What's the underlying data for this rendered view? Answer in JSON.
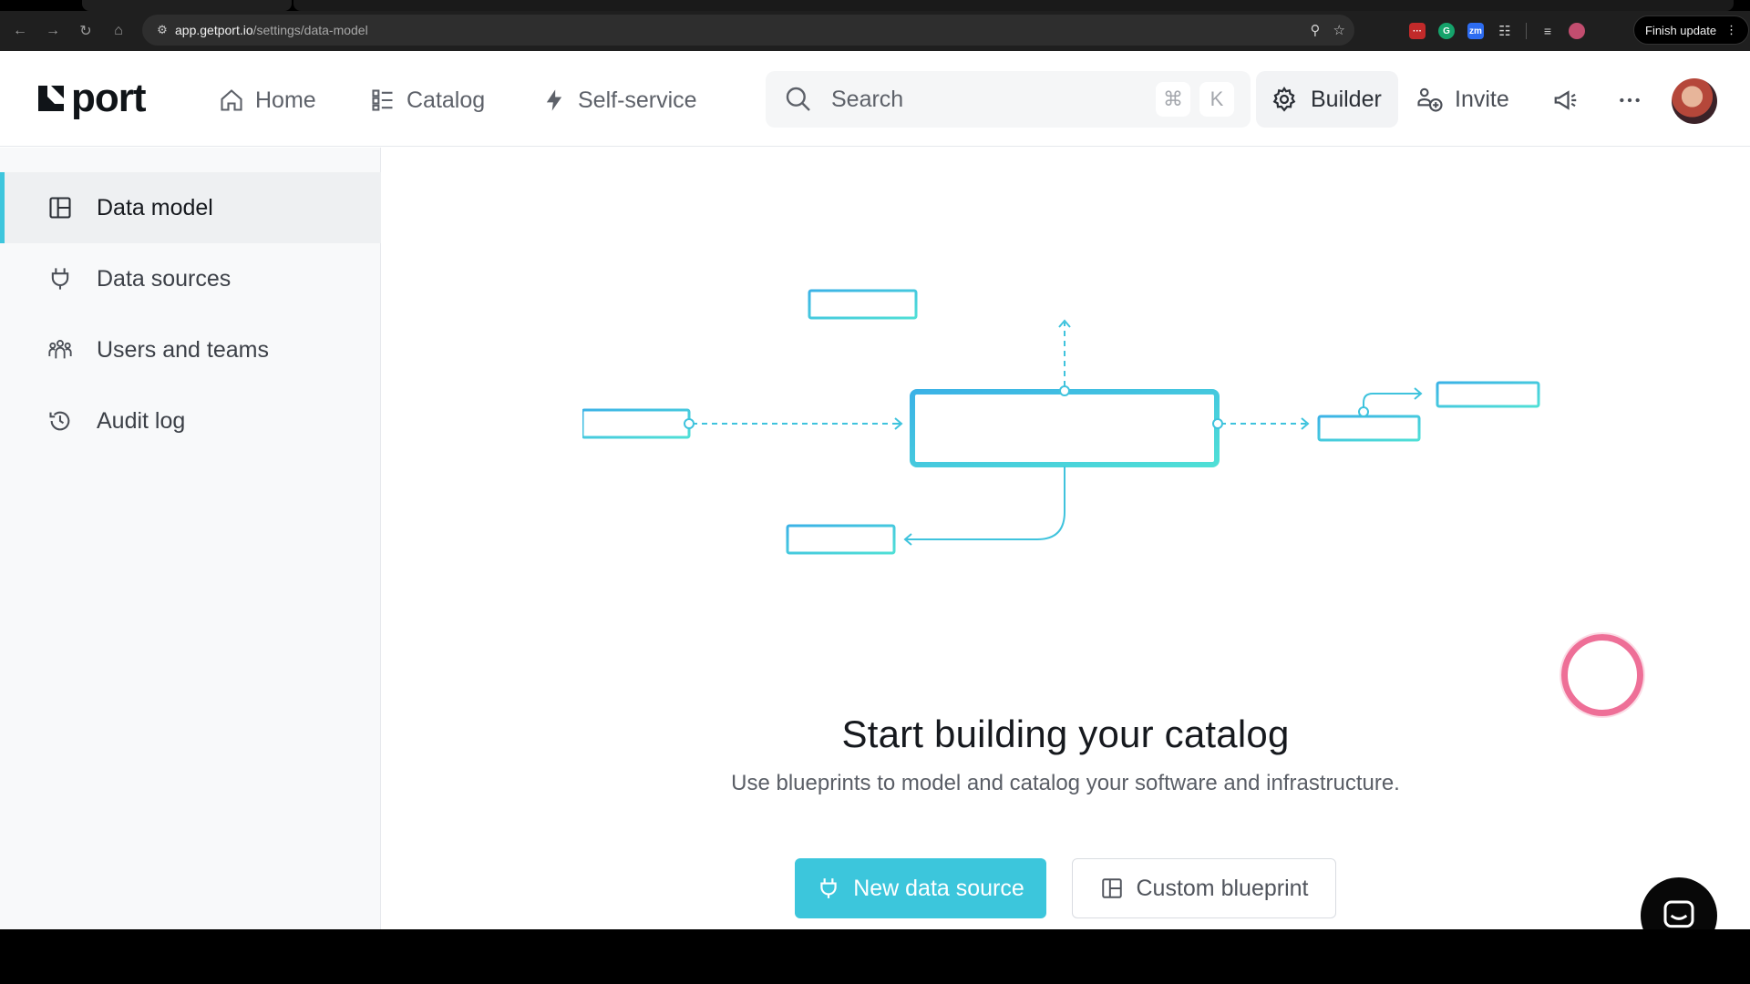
{
  "browser": {
    "url_host": "app.getport.io",
    "url_path": "/settings/data-model",
    "finish_update_label": "Finish update"
  },
  "app": {
    "logo_text": "port",
    "nav": {
      "home": "Home",
      "catalog": "Catalog",
      "self_service": "Self-service"
    },
    "search": {
      "placeholder": "Search",
      "shortcut_mod": "⌘",
      "shortcut_key": "K"
    },
    "builder_label": "Builder",
    "invite_label": "Invite"
  },
  "sidebar": {
    "items": [
      {
        "label": "Data model",
        "icon": "layout-icon",
        "active": true
      },
      {
        "label": "Data sources",
        "icon": "plug-icon",
        "active": false
      },
      {
        "label": "Users and teams",
        "icon": "users-icon",
        "active": false
      },
      {
        "label": "Audit log",
        "icon": "history-icon",
        "active": false
      }
    ]
  },
  "empty_state": {
    "title": "Start building your catalog",
    "subtitle": "Use blueprints to model and catalog your software and infrastructure.",
    "primary_button": "New data source",
    "secondary_button": "Custom blueprint"
  },
  "colors": {
    "accent": "#3cc6dc",
    "cursor_ring": "#ee6f97"
  }
}
